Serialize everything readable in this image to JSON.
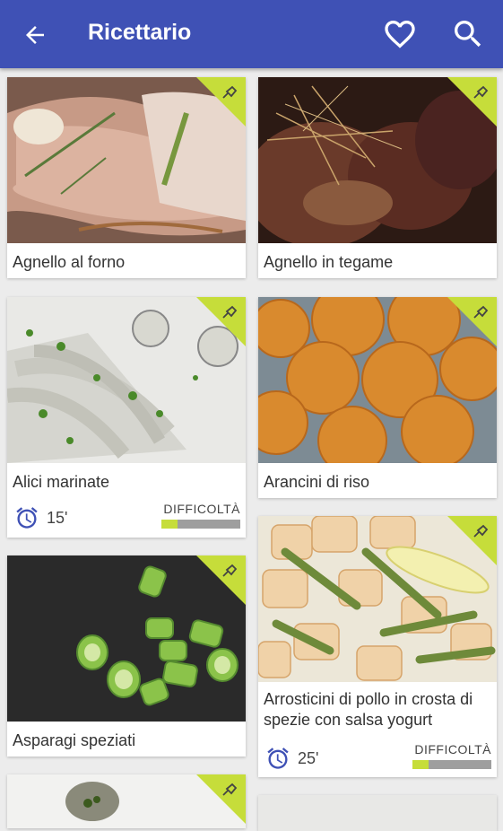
{
  "app_bar": {
    "title": "Ricettario",
    "back_icon": "arrow-back-icon",
    "favorite_icon": "heart-outline-icon",
    "search_icon": "search-icon",
    "color": "#3f51b5"
  },
  "accent_color": "#c6dd3a",
  "recipes": [
    {
      "name": "Agnello al forno"
    },
    {
      "name": "Agnello in tegame"
    },
    {
      "name": "Alici marinate",
      "time": "15'",
      "difficulty_label": "DIFFICOLTÀ",
      "difficulty_level": 0.2
    },
    {
      "name": "Arancini di riso"
    },
    {
      "name": "Asparagi speziati"
    },
    {
      "name": "Arrosticini di pollo in crosta di spezie con salsa yogurt",
      "time": "25'",
      "difficulty_label": "DIFFICOLTÀ",
      "difficulty_level": 0.2
    }
  ]
}
